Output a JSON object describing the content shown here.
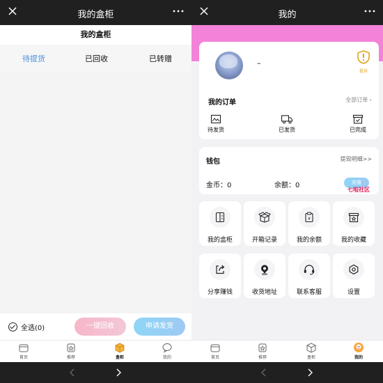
{
  "left": {
    "titlebar": {
      "title": "我的盒柜"
    },
    "header": {
      "title": "我的盒柜"
    },
    "tabs": [
      {
        "label": "待提货",
        "active": true
      },
      {
        "label": "已回收",
        "active": false
      },
      {
        "label": "已转赠",
        "active": false
      }
    ],
    "action_bar": {
      "select_all": "全选(0)",
      "recycle_button": "一键回收",
      "ship_button": "申请发货"
    },
    "bottom_nav": [
      {
        "label": "首页",
        "icon": "home-icon"
      },
      {
        "label": "推荐",
        "icon": "star-bag-icon"
      },
      {
        "label": "盒柜",
        "icon": "box-icon",
        "active": true
      },
      {
        "label": "我的",
        "icon": "chat-icon"
      }
    ]
  },
  "right": {
    "titlebar": {
      "title": "我的"
    },
    "profile": {
      "username": "–",
      "report_label": "投诉"
    },
    "orders": {
      "title": "我的订单",
      "all_link": "全部订单",
      "items": [
        {
          "label": "待发货",
          "icon": "photo-frame-icon"
        },
        {
          "label": "已发货",
          "icon": "truck-icon"
        },
        {
          "label": "已完成",
          "icon": "archive-check-icon"
        }
      ]
    },
    "wallet": {
      "title": "钱包",
      "detail_link": "提现明细>>",
      "coins_label": "金币：0",
      "balance_label": "余额：0",
      "recharge_button": "充值",
      "watermark": "七啦社区"
    },
    "grid": [
      {
        "label": "我的盒柜",
        "icon": "cabinet-icon"
      },
      {
        "label": "开箱记录",
        "icon": "open-box-icon"
      },
      {
        "label": "我的余额",
        "icon": "clipboard-yen-icon"
      },
      {
        "label": "我的收藏",
        "icon": "star-box-icon"
      },
      {
        "label": "分享赚钱",
        "icon": "share-icon"
      },
      {
        "label": "收货地址",
        "icon": "location-pin-icon"
      },
      {
        "label": "联系客服",
        "icon": "headset-icon"
      },
      {
        "label": "设置",
        "icon": "hexagon-settings-icon"
      }
    ],
    "bottom_nav": [
      {
        "label": "首页",
        "icon": "home-icon"
      },
      {
        "label": "推荐",
        "icon": "star-bag-icon"
      },
      {
        "label": "盒柜",
        "icon": "box-icon"
      },
      {
        "label": "我的",
        "icon": "avatar-icon",
        "active": true
      }
    ]
  },
  "colors": {
    "accent_blue": "#4a8fd8",
    "pink_band": "#f382d8",
    "recycle_pink": "#f6b6c8",
    "ship_blue": "#8ed6f7",
    "report_orange": "#e3a31a",
    "watermark_red": "#e0245e"
  }
}
